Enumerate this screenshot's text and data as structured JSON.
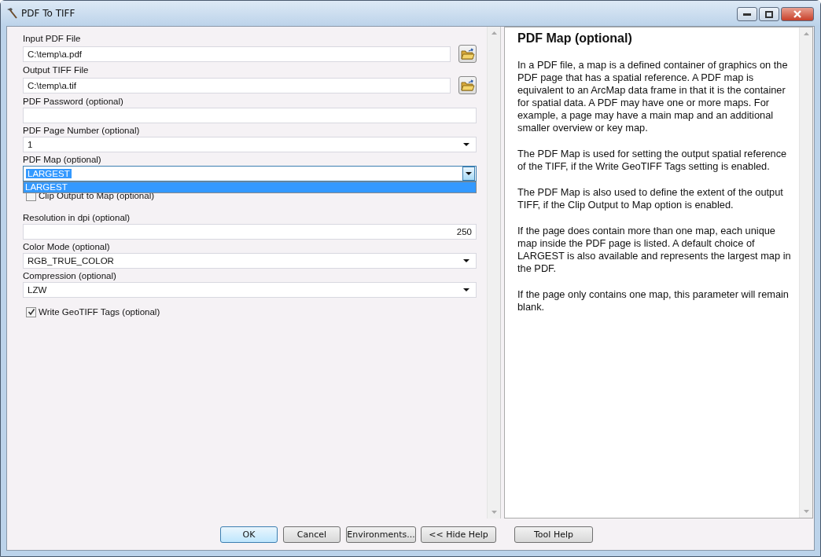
{
  "window": {
    "title": "PDF To TIFF"
  },
  "params": [
    {
      "kind": "file",
      "label": "Input PDF File",
      "value": "C:\\temp\\a.pdf"
    },
    {
      "kind": "file",
      "label": "Output TIFF File",
      "value": "C:\\temp\\a.tif"
    },
    {
      "kind": "text",
      "label": "PDF Password (optional)"
    },
    {
      "kind": "combo",
      "label": "PDF Page Number (optional)",
      "value": "1",
      "open": false
    },
    {
      "kind": "combo",
      "label": "PDF Map (optional)",
      "value": "LARGEST",
      "open": true,
      "options": [
        {
          "label": "LARGEST",
          "selected": true
        }
      ]
    },
    {
      "kind": "checkbox",
      "label": "Clip Output to Map (optional)",
      "checked": false
    },
    {
      "kind": "number",
      "label": "Resolution in dpi (optional)",
      "value": "250"
    },
    {
      "kind": "combo",
      "label": "Color Mode (optional)",
      "value": "RGB_TRUE_COLOR",
      "open": false
    },
    {
      "kind": "combo",
      "label": "Compression (optional)",
      "value": "LZW",
      "open": false
    },
    {
      "kind": "checkbox",
      "label": "Write GeoTIFF Tags (optional)",
      "checked": true
    }
  ],
  "help": {
    "title": "PDF Map (optional)",
    "paragraphs": [
      "In a PDF file, a map is a defined container of graphics on the PDF page that has a spatial reference. A PDF map is equivalent to an ArcMap data frame in that it is the container for spatial data. A PDF may have one or more maps. For example, a page may have a main map and an additional smaller overview or key map.",
      "The PDF Map is used for setting the output spatial reference of the TIFF, if the Write GeoTIFF Tags setting is enabled.",
      "The PDF Map is also used to define the extent of the output TIFF, if the Clip Output to Map option is enabled.",
      "If the page does contain more than one map, each unique map inside the PDF page is listed. A default choice of LARGEST is also available and represents the largest map in the PDF.",
      "If the page only contains one map, this parameter will remain blank."
    ]
  },
  "buttons": [
    {
      "label": "OK",
      "default": true
    },
    {
      "label": "Cancel",
      "default": false
    },
    {
      "label": "Environments...",
      "default": false
    },
    {
      "label": "<< Hide Help",
      "default": false
    },
    {
      "label": "Tool Help",
      "default": false
    }
  ]
}
